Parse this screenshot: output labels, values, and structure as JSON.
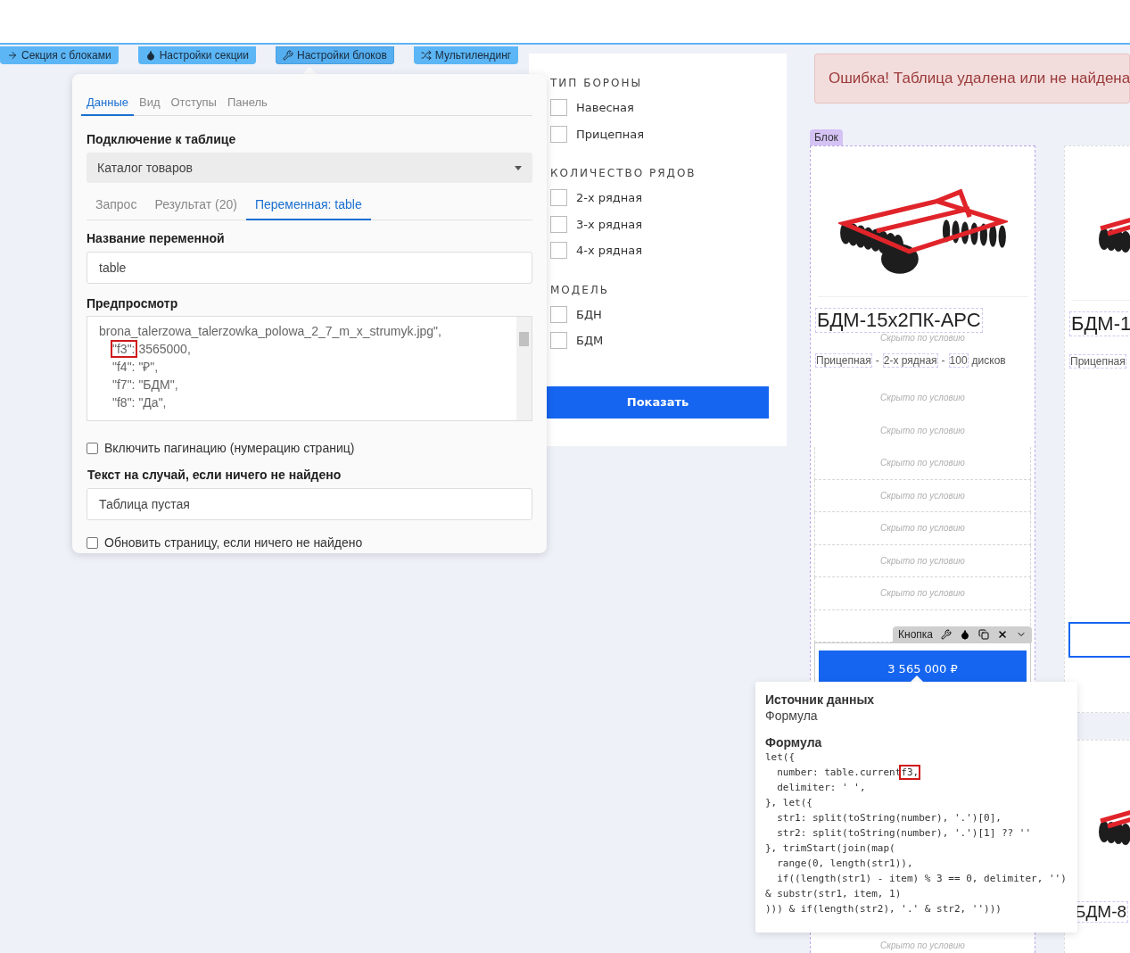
{
  "toolbar": [
    {
      "label": "Секция с блоками",
      "selected": false
    },
    {
      "label": "Настройки секции",
      "selected": false
    },
    {
      "label": "Настройки блоков",
      "selected": true
    },
    {
      "label": "Мультилендинг",
      "selected": false
    }
  ],
  "settings_panel": {
    "tabs": [
      {
        "label": "Данные",
        "selected": true
      },
      {
        "label": "Вид",
        "selected": false
      },
      {
        "label": "Отступы",
        "selected": false
      },
      {
        "label": "Панель",
        "selected": false
      }
    ],
    "connection_label": "Подключение к таблице",
    "table_select": {
      "value": "Каталог товаров"
    },
    "query_tabs": [
      {
        "label": "Запрос",
        "selected": false
      },
      {
        "label": "Результат (20)",
        "selected": false
      },
      {
        "label": "Переменная: table",
        "selected": true
      }
    ],
    "variable_label": "Название переменной",
    "variable_input": {
      "value": "table"
    },
    "preview_label": "Предпросмотр",
    "preview_lines": [
      {
        "indent": false,
        "parts": [
          {
            "text": "brona_talerzowa_talerzowka_polowa_2_7_m_x_strumyk.jpg\",",
            "marked": false
          }
        ]
      },
      {
        "indent": true,
        "parts": [
          {
            "text": "\"f3\":",
            "marked": true
          },
          {
            "text": " 3565000,",
            "marked": false
          }
        ]
      },
      {
        "indent": true,
        "parts": [
          {
            "text": "\"f4\": \"₽\",",
            "marked": false
          }
        ]
      },
      {
        "indent": true,
        "parts": [
          {
            "text": "\"f7\": \"БДМ\",",
            "marked": false
          }
        ]
      },
      {
        "indent": true,
        "parts": [
          {
            "text": "\"f8\": \"Да\",",
            "marked": false
          }
        ]
      }
    ],
    "pagination": {
      "label": "Включить пагинацию (нумерацию страниц)",
      "checked": false
    },
    "empty_text_label": "Текст на случай, если ничего не найдено",
    "empty_text_input": {
      "value": "Таблица пустая"
    },
    "refresh": {
      "label": "Обновить страницу, если ничего не найдено",
      "checked": false
    }
  },
  "filter": {
    "groups": [
      {
        "title": "ТИП БОРОНЫ",
        "options": [
          {
            "label": "Навесная",
            "checked": false
          },
          {
            "label": "Прицепная",
            "checked": false
          }
        ]
      },
      {
        "title": "КОЛИЧЕСТВО РЯДОВ",
        "options": [
          {
            "label": "2-х рядная",
            "checked": false
          },
          {
            "label": "3-х рядная",
            "checked": false
          },
          {
            "label": "4-х рядная",
            "checked": false
          }
        ]
      },
      {
        "title": "МОДЕЛЬ",
        "options": [
          {
            "label": "БДН",
            "checked": false
          },
          {
            "label": "БДМ",
            "checked": false
          }
        ]
      }
    ],
    "submit": "Показать"
  },
  "error_banner": "Ошибка! Таблица удалена или не найдена",
  "main_card": {
    "block_label": "Блок",
    "title": "БДМ-15х2ПК-АРС",
    "title_note": "Скрыто по условию",
    "tags": [
      {
        "text": "Прицепная",
        "boxed": true
      },
      {
        "text": "-",
        "boxed": false
      },
      {
        "text": "2-х рядная",
        "boxed": true
      },
      {
        "text": "-",
        "boxed": false
      },
      {
        "text": "100",
        "boxed": true
      },
      {
        "text": "дисков",
        "boxed": false
      }
    ],
    "hidden_rows": [
      "Скрыто по условию",
      "Скрыто по условию",
      "Скрыто по условию",
      "Скрыто по условию",
      "Скрыто по условию",
      "Скрыто по условию",
      "Скрыто по условию"
    ],
    "element_toolbar": {
      "label": "Кнопка"
    },
    "price_button": "3 565 000 ₽",
    "bottom_note": "Скрыто по условию"
  },
  "side_cards": [
    {
      "kind": "top",
      "title": "БДМ-1",
      "tags": [
        {
          "text": "Прицепная",
          "boxed": true
        }
      ]
    },
    {
      "kind": "bottom",
      "title": "БДМ-8"
    }
  ],
  "formula_popover": {
    "source_label": "Источник данных",
    "source_value": "Формула",
    "formula_label": "Формула",
    "code_lines": [
      {
        "parts": [
          {
            "text": "let({",
            "marked": false
          }
        ]
      },
      {
        "parts": [
          {
            "text": "  number: table.current",
            "marked": false
          },
          {
            "text": "f3,",
            "marked": true
          }
        ]
      },
      {
        "parts": [
          {
            "text": "  delimiter: ' ',",
            "marked": false
          }
        ]
      },
      {
        "parts": [
          {
            "text": "}, let({",
            "marked": false
          }
        ]
      },
      {
        "parts": [
          {
            "text": "  str1: split(toString(number), '.')[0],",
            "marked": false
          }
        ]
      },
      {
        "parts": [
          {
            "text": "  str2: split(toString(number), '.')[1] ?? ''",
            "marked": false
          }
        ]
      },
      {
        "parts": [
          {
            "text": "}, trimStart(join(map(",
            "marked": false
          }
        ]
      },
      {
        "parts": [
          {
            "text": "  range(0, length(str1)),",
            "marked": false
          }
        ]
      },
      {
        "parts": [
          {
            "text": "  if((length(str1) - item) % 3 == 0, delimiter, '')",
            "marked": false
          }
        ]
      },
      {
        "parts": [
          {
            "text": "& substr(str1, item, 1)",
            "marked": false
          }
        ]
      },
      {
        "parts": [
          {
            "text": "))) & if(length(str2), '.' & str2, '')))",
            "marked": false
          }
        ]
      }
    ]
  }
}
